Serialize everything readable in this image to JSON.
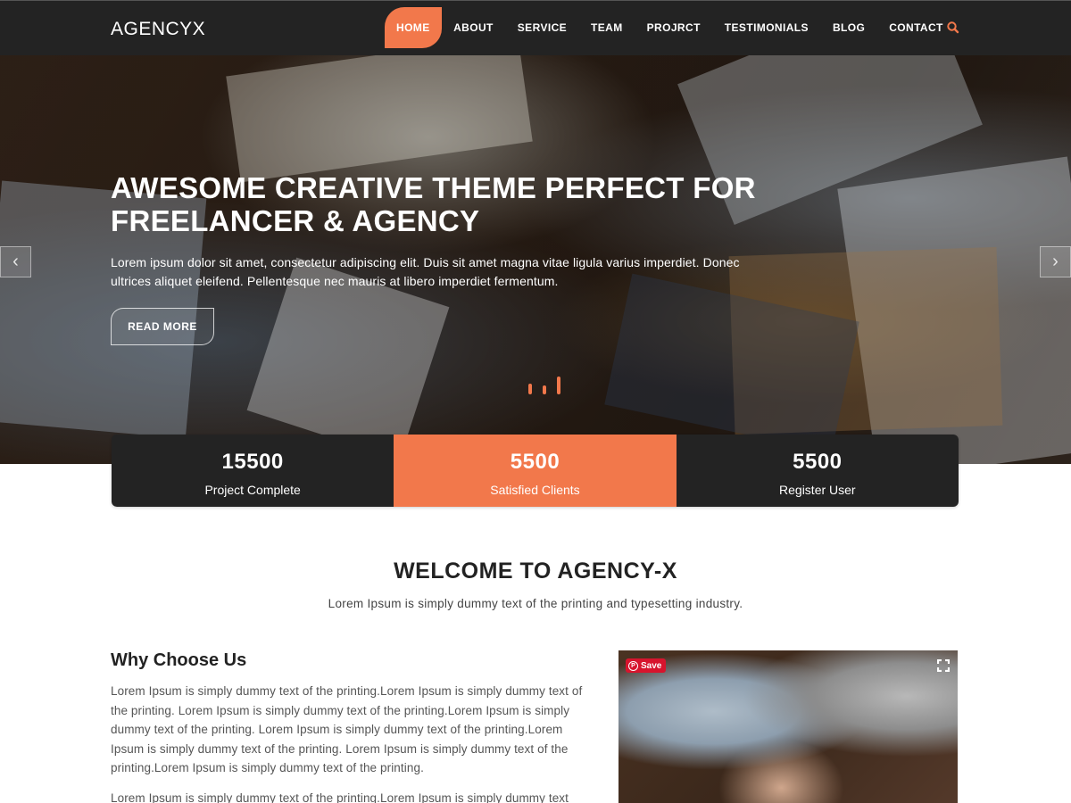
{
  "header": {
    "logo": "AGENCYX",
    "nav": [
      {
        "label": "HOME",
        "active": true
      },
      {
        "label": "ABOUT"
      },
      {
        "label": "SERVICE"
      },
      {
        "label": "TEAM"
      },
      {
        "label": "PROJRCT"
      },
      {
        "label": "TESTIMONIALS"
      },
      {
        "label": "BLOG"
      },
      {
        "label": "CONTACT"
      }
    ],
    "search_icon": "search-icon"
  },
  "hero": {
    "title": "AWESOME CREATIVE THEME PERFECT FOR FREELANCER & AGENCY",
    "text": "Lorem ipsum dolor sit amet, consectetur adipiscing elit. Duis sit amet magna vitae ligula varius imperdiet. Donec ultrices aliquet eleifend. Pellentesque nec mauris at libero imperdiet fermentum.",
    "button": "READ MORE",
    "prev_arrow": "‹",
    "next_arrow": "›",
    "slides": 3,
    "active_slide": 3
  },
  "counters": [
    {
      "value": "15500",
      "label": "Project Complete"
    },
    {
      "value": "5500",
      "label": "Satisfied Clients"
    },
    {
      "value": "5500",
      "label": "Register User"
    }
  ],
  "welcome": {
    "title": "WELCOME TO AGENCY-X",
    "subtitle": "Lorem Ipsum is simply dummy text of the printing and typesetting industry."
  },
  "why": {
    "title": "Why Choose Us",
    "paragraphs": [
      "Lorem Ipsum is simply dummy text of the printing.Lorem Ipsum is simply dummy text of the printing. Lorem Ipsum is simply dummy text of the printing.Lorem Ipsum is simply dummy text of the printing. Lorem Ipsum is simply dummy text of the printing.Lorem Ipsum is simply dummy text of the printing. Lorem Ipsum is simply dummy text of the printing.Lorem Ipsum is simply dummy text of the printing.",
      "Lorem Ipsum is simply dummy text of the printing.Lorem Ipsum is simply dummy text"
    ]
  },
  "media": {
    "save_label": "Save",
    "pin_glyph": "P"
  },
  "colors": {
    "accent": "#f2784b",
    "header_bg": "#232323",
    "pinterest": "#d7142d"
  }
}
